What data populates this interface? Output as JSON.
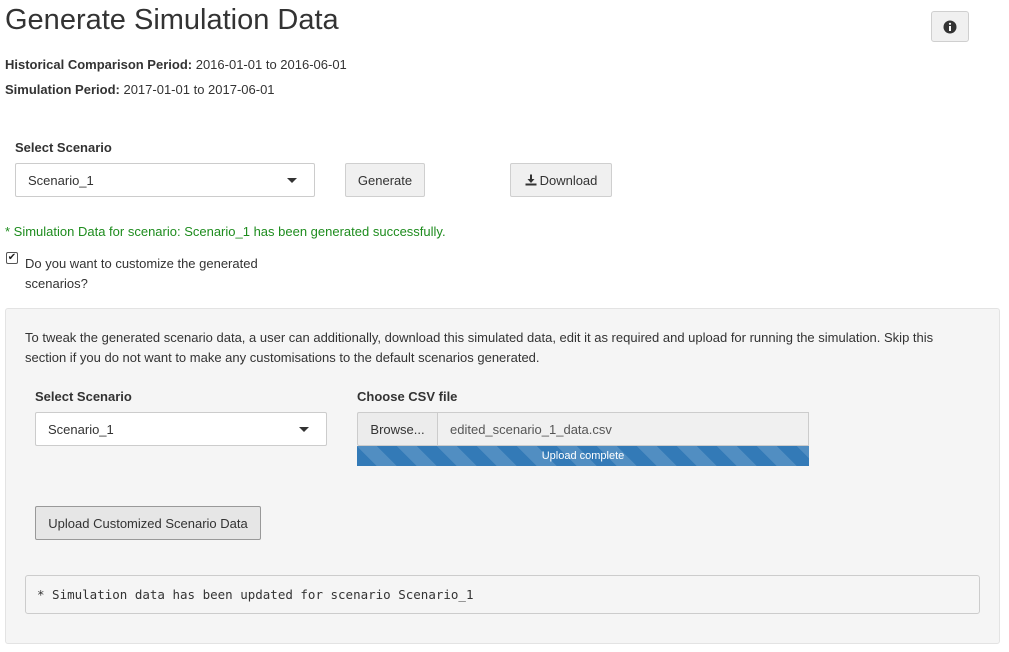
{
  "header": {
    "title": "Generate Simulation Data",
    "info_icon": "info-circle-icon"
  },
  "periods": {
    "historical_label": "Historical Comparison Period:",
    "historical_value": "2016-01-01 to 2016-06-01",
    "simulation_label": "Simulation Period:",
    "simulation_value": "2017-01-01 to 2017-06-01"
  },
  "generate_section": {
    "select_label": "Select Scenario",
    "selected_scenario": "Scenario_1",
    "generate_button": "Generate",
    "download_button": "Download",
    "download_icon": "download-icon",
    "success_message": "* Simulation Data for scenario: Scenario_1 has been generated successfully.",
    "success_color": "#1e8c1e"
  },
  "customize": {
    "checkbox_checked": true,
    "checkbox_label": "Do you want to customize the generated scenarios?",
    "description": "To tweak the generated scenario data, a user can additionally, download this simulated data, edit it as required and upload for running the simulation. Skip this section if you do not want to make any customisations to the default scenarios generated.",
    "select_label": "Select Scenario",
    "selected_scenario": "Scenario_1",
    "file_label": "Choose CSV file",
    "browse_button": "Browse...",
    "file_name": "edited_scenario_1_data.csv",
    "progress_text": "Upload complete",
    "progress_fraction": 1.0,
    "progress_color": "#337ab7",
    "upload_button": "Upload Customized Scenario Data",
    "output_text": "* Simulation data has been updated for scenario Scenario_1"
  }
}
